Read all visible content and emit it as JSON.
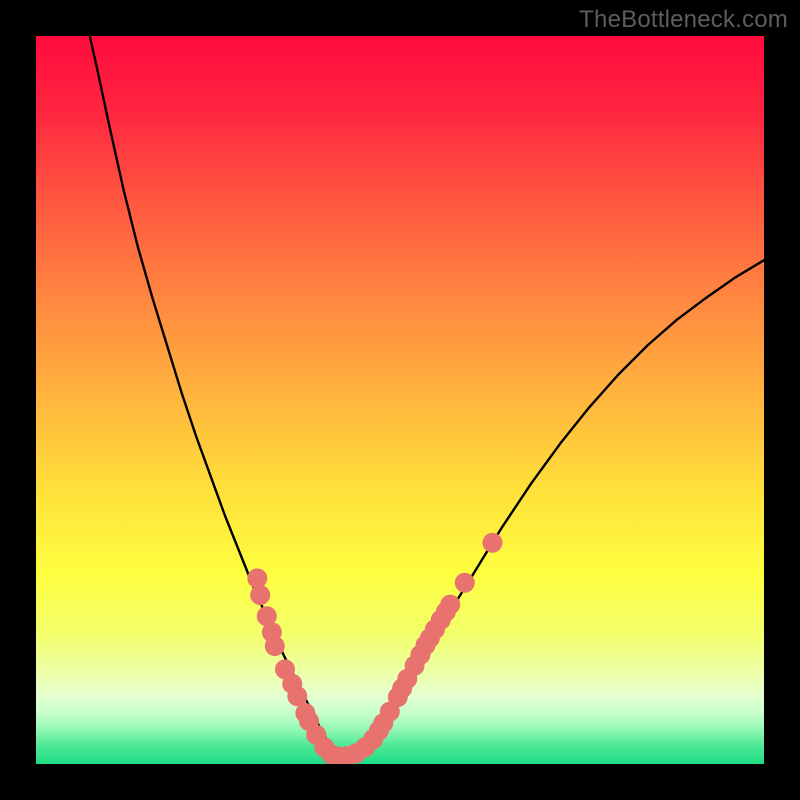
{
  "watermark": "TheBottleneck.com",
  "gradient_stops": [
    {
      "offset": 0.0,
      "color": "#ff0b3d"
    },
    {
      "offset": 0.1,
      "color": "#ff2540"
    },
    {
      "offset": 0.22,
      "color": "#ff5440"
    },
    {
      "offset": 0.35,
      "color": "#ff8340"
    },
    {
      "offset": 0.48,
      "color": "#ffaf3e"
    },
    {
      "offset": 0.62,
      "color": "#ffdf3a"
    },
    {
      "offset": 0.74,
      "color": "#fdff40"
    },
    {
      "offset": 0.82,
      "color": "#f3ff6a"
    },
    {
      "offset": 0.875,
      "color": "#ecffa8"
    },
    {
      "offset": 0.905,
      "color": "#e6ffd0"
    },
    {
      "offset": 0.93,
      "color": "#c8ffcc"
    },
    {
      "offset": 0.955,
      "color": "#8cf7b0"
    },
    {
      "offset": 0.975,
      "color": "#4de896"
    },
    {
      "offset": 1.0,
      "color": "#1fdc86"
    }
  ],
  "curve_color": "#000000",
  "marker_color": "#e7726e",
  "marker_radius": 10,
  "chart_data": {
    "type": "line",
    "title": "",
    "xlabel": "",
    "ylabel": "",
    "xlim": [
      0,
      100
    ],
    "ylim": [
      0,
      100
    ],
    "series": [
      {
        "name": "curve",
        "x": [
          7.4,
          8.5,
          10,
          12,
          14,
          16,
          18,
          20,
          22,
          24,
          26,
          28,
          30,
          32,
          34,
          35.5,
          37,
          38,
          39,
          40,
          41.2,
          42.5,
          44,
          46,
          48,
          50,
          53,
          56,
          60,
          64,
          68,
          72,
          76,
          80,
          84,
          88,
          92,
          96,
          100
        ],
        "y": [
          100,
          95,
          88,
          79,
          71,
          64,
          57.5,
          51,
          45,
          39.5,
          34,
          29,
          24,
          19.5,
          15,
          12,
          9,
          7,
          5,
          3.2,
          1.8,
          1,
          1.4,
          3,
          5.6,
          9,
          14,
          19.5,
          26,
          32.5,
          38.5,
          44,
          49,
          53.5,
          57.5,
          61,
          64,
          66.8,
          69.2
        ]
      }
    ],
    "markers": [
      {
        "x": 30.4,
        "y": 25.5
      },
      {
        "x": 30.8,
        "y": 23.2
      },
      {
        "x": 31.7,
        "y": 20.3
      },
      {
        "x": 32.4,
        "y": 18.1
      },
      {
        "x": 32.8,
        "y": 16.2
      },
      {
        "x": 34.2,
        "y": 13.0
      },
      {
        "x": 35.2,
        "y": 11.0
      },
      {
        "x": 35.9,
        "y": 9.3
      },
      {
        "x": 37.0,
        "y": 7.0
      },
      {
        "x": 37.5,
        "y": 5.9
      },
      {
        "x": 38.5,
        "y": 4.0
      },
      {
        "x": 39.6,
        "y": 2.3
      },
      {
        "x": 40.6,
        "y": 1.3
      },
      {
        "x": 41.7,
        "y": 1.0
      },
      {
        "x": 42.8,
        "y": 1.1
      },
      {
        "x": 44.0,
        "y": 1.5
      },
      {
        "x": 45.2,
        "y": 2.3
      },
      {
        "x": 46.3,
        "y": 3.4
      },
      {
        "x": 47.1,
        "y": 4.6
      },
      {
        "x": 47.7,
        "y": 5.6
      },
      {
        "x": 48.6,
        "y": 7.2
      },
      {
        "x": 49.7,
        "y": 9.2
      },
      {
        "x": 50.3,
        "y": 10.4
      },
      {
        "x": 51.0,
        "y": 11.7
      },
      {
        "x": 52.0,
        "y": 13.5
      },
      {
        "x": 52.8,
        "y": 15.0
      },
      {
        "x": 53.5,
        "y": 16.3
      },
      {
        "x": 54.1,
        "y": 17.3
      },
      {
        "x": 54.8,
        "y": 18.5
      },
      {
        "x": 55.6,
        "y": 19.8
      },
      {
        "x": 56.3,
        "y": 20.9
      },
      {
        "x": 56.9,
        "y": 21.9
      },
      {
        "x": 58.9,
        "y": 24.9
      },
      {
        "x": 62.7,
        "y": 30.4
      }
    ]
  }
}
